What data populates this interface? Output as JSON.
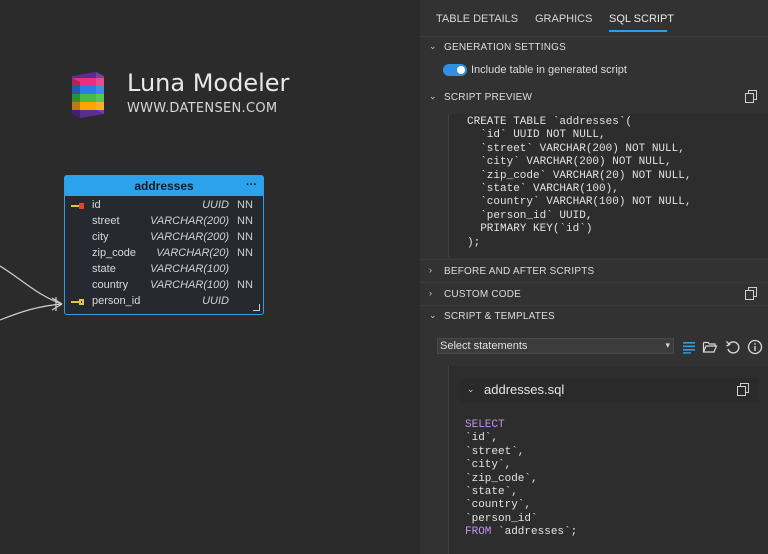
{
  "brand": {
    "title": "Luna Modeler",
    "url": "WWW.DATENSEN.COM"
  },
  "entity": {
    "name": "addresses",
    "menu_icon": "more-horizontal-icon",
    "columns": [
      {
        "name": "id",
        "type": "UUID",
        "nn": "NN",
        "key": "pk"
      },
      {
        "name": "street",
        "type": "VARCHAR(200)",
        "nn": "NN",
        "key": ""
      },
      {
        "name": "city",
        "type": "VARCHAR(200)",
        "nn": "NN",
        "key": ""
      },
      {
        "name": "zip_code",
        "type": "VARCHAR(20)",
        "nn": "NN",
        "key": ""
      },
      {
        "name": "state",
        "type": "VARCHAR(100)",
        "nn": "",
        "key": ""
      },
      {
        "name": "country",
        "type": "VARCHAR(100)",
        "nn": "NN",
        "key": ""
      },
      {
        "name": "person_id",
        "type": "UUID",
        "nn": "",
        "key": "fk"
      }
    ]
  },
  "tabs": [
    {
      "label": "TABLE DETAILS",
      "active": false
    },
    {
      "label": "GRAPHICS",
      "active": false
    },
    {
      "label": "SQL SCRIPT",
      "active": true
    }
  ],
  "sections": {
    "generation": "GENERATION SETTINGS",
    "preview": "SCRIPT PREVIEW",
    "before_after": "BEFORE AND AFTER SCRIPTS",
    "custom_code": "CUSTOM CODE",
    "templates": "SCRIPT & TEMPLATES"
  },
  "toggle": {
    "label": "Include table in generated script",
    "checked": true
  },
  "script_preview": [
    "CREATE TABLE `addresses`(",
    "  `id` UUID NOT NULL,",
    "  `street` VARCHAR(200) NOT NULL,",
    "  `city` VARCHAR(200) NOT NULL,",
    "  `zip_code` VARCHAR(20) NOT NULL,",
    "  `state` VARCHAR(100),",
    "  `country` VARCHAR(100) NOT NULL,",
    "  `person_id` UUID,",
    "  PRIMARY KEY(`id`)",
    ");"
  ],
  "select": {
    "value": "Select statements"
  },
  "toolbar_icons": [
    "list-icon",
    "folder-open-icon",
    "undo-icon",
    "info-icon"
  ],
  "file": {
    "name": "addresses.sql"
  },
  "sql_lines": [
    {
      "kw": "SELECT",
      "text": ""
    },
    {
      "kw": "",
      "text": "`id`,"
    },
    {
      "kw": "",
      "text": "`street`,"
    },
    {
      "kw": "",
      "text": "`city`,"
    },
    {
      "kw": "",
      "text": "`zip_code`,"
    },
    {
      "kw": "",
      "text": "`state`,"
    },
    {
      "kw": "",
      "text": "`country`,"
    },
    {
      "kw": "",
      "text": "`person_id`"
    },
    {
      "kw": "FROM",
      "text": " `addresses`;"
    }
  ],
  "colors": {
    "accent": "#2f9ee6",
    "keyword": "#c490ef",
    "panel_bg": "#323232",
    "canvas_bg": "#2b2b2b"
  }
}
